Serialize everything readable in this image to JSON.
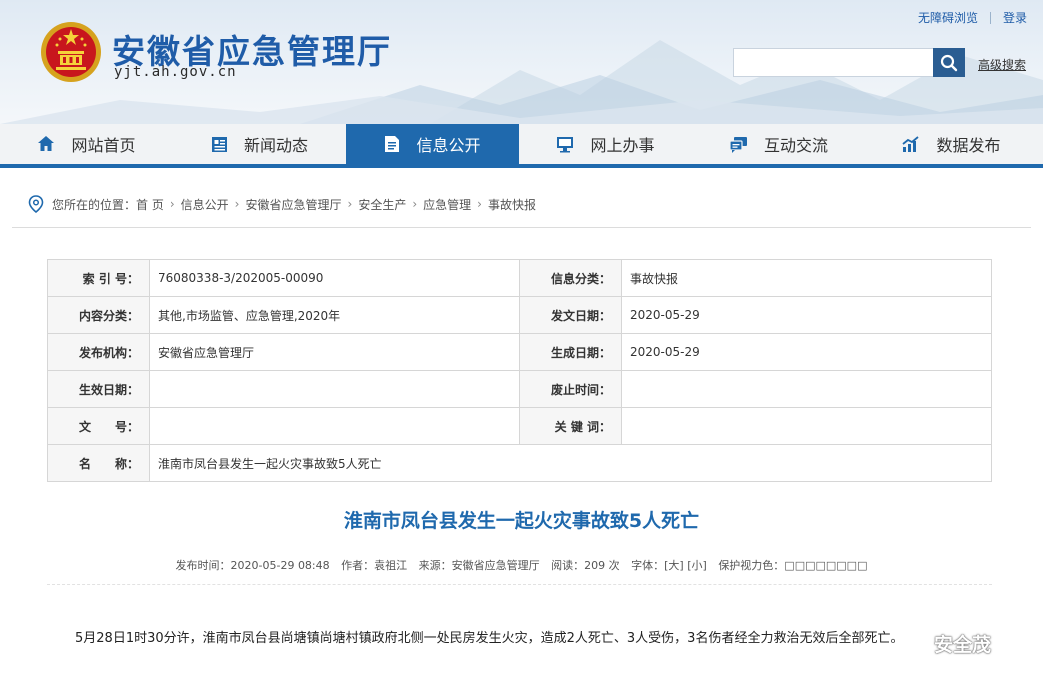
{
  "header": {
    "site_title": "安徽省应急管理厅",
    "site_url": "yjt.ah.gov.cn",
    "accessibility_link": "无障碍浏览",
    "login_link": "登录",
    "search_placeholder": "",
    "advanced_search": "高级搜索"
  },
  "nav": {
    "items": [
      {
        "label": "网站首页",
        "icon": "home-icon"
      },
      {
        "label": "新闻动态",
        "icon": "news-icon"
      },
      {
        "label": "信息公开",
        "icon": "document-icon",
        "active": true
      },
      {
        "label": "网上办事",
        "icon": "monitor-icon"
      },
      {
        "label": "互动交流",
        "icon": "chat-icon"
      },
      {
        "label": "数据发布",
        "icon": "chart-icon"
      }
    ],
    "active_color": "#1f69ad"
  },
  "breadcrumb": {
    "prefix": "您所在的位置：",
    "items": [
      "首 页",
      "信息公开",
      "安徽省应急管理厅",
      "安全生产",
      "应急管理",
      "事故快报"
    ]
  },
  "info_table": {
    "index_label": "索 引 号：",
    "index_value": "76080338-3/202005-00090",
    "category_label": "信息分类：",
    "category_value": "事故快报",
    "content_label": "内容分类：",
    "content_value": "其他,市场监管、应急管理,2020年",
    "date_label": "发文日期：",
    "date_value": "2020-05-29",
    "org_label": "发布机构：",
    "org_value": "安徽省应急管理厅",
    "gen_label": "生成日期：",
    "gen_value": "2020-05-29",
    "effective_label": "生效日期：",
    "effective_value": "",
    "abolish_label": "废止时间：",
    "abolish_value": "",
    "docno_label": "文　　号：",
    "docno_value": "",
    "keyword_label": "关 键 词：",
    "keyword_value": "",
    "name_label": "名　　称：",
    "name_value": "淮南市凤台县发生一起火灾事故致5人死亡"
  },
  "article": {
    "title": "淮南市凤台县发生一起火灾事故致5人死亡",
    "publish_time": "发布时间：2020-05-29 08:48",
    "author": "作者：袁祖江",
    "source": "来源：安徽省应急管理厅",
    "views": "阅读：209 次",
    "font_size": "字体：[大] [小]",
    "eye_care": "保护视力色：□□□□□□□□",
    "body": "5月28日1时30分许，淮南市凤台县尚塘镇尚塘村镇政府北侧一处民房发生火灾，造成2人死亡、3人受伤，3名伤者经全力救治无效后全部死亡。"
  },
  "watermark": {
    "text": "安全茂"
  }
}
